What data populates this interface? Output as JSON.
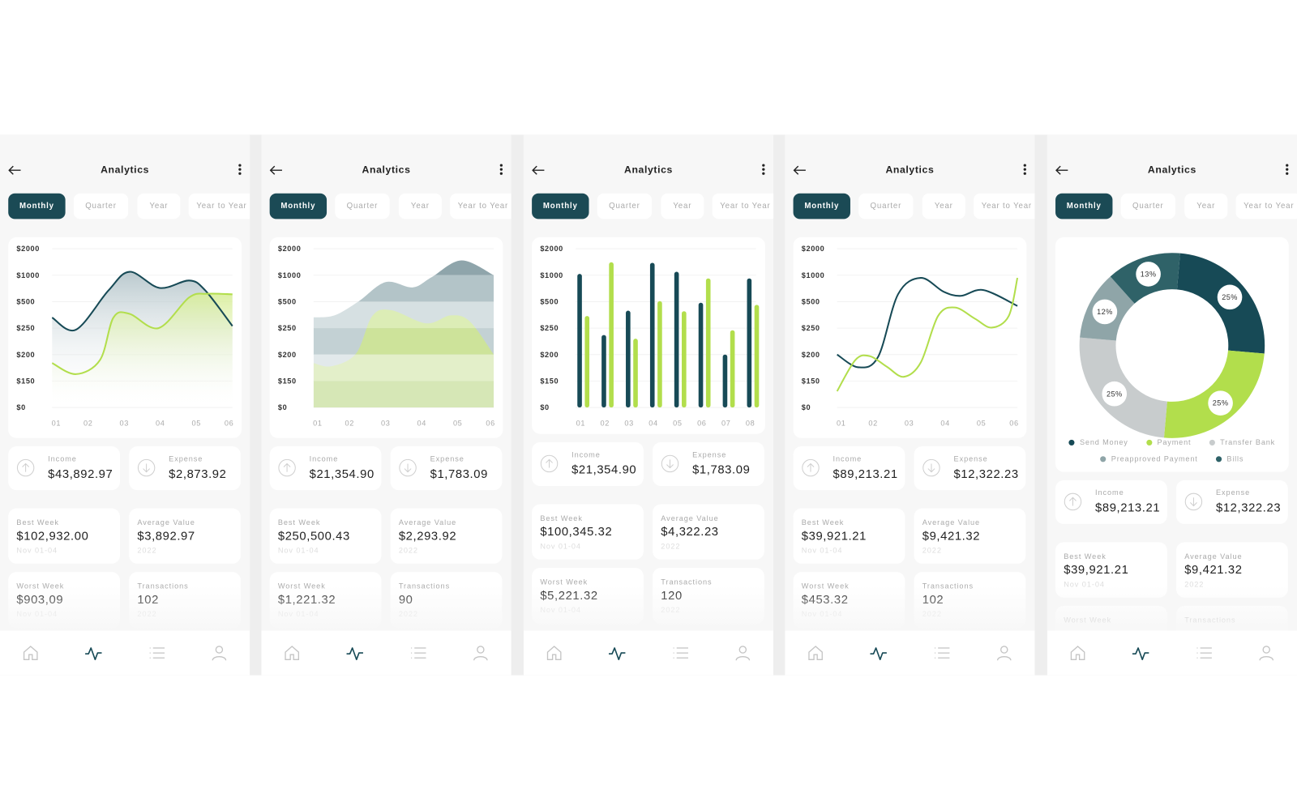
{
  "common": {
    "title": "Analytics",
    "tabs": [
      "Monthly",
      "Quarter",
      "Year",
      "Year to Year"
    ],
    "active_tab": "Monthly",
    "nav": [
      "home-icon",
      "activity-icon",
      "list-icon",
      "user-icon"
    ],
    "active_nav": "activity-icon",
    "income_label": "Income",
    "expense_label": "Expense"
  },
  "colors": {
    "dark": "#174a56",
    "green": "#b2de4c",
    "accent_tab": "#1b4a55"
  },
  "phones": [
    {
      "summary": {
        "income": "$43,892.97",
        "expense": "$2,873.92"
      },
      "stats": [
        {
          "label": "Best Week",
          "value": "$102,932.00",
          "sub": "Nov 01-04"
        },
        {
          "label": "Average Value",
          "value": "$3,892.97",
          "sub": "2022"
        },
        {
          "label": "Worst Week",
          "value": "$903,09",
          "sub": "Nov 01-04"
        },
        {
          "label": "Transactions",
          "value": "102",
          "sub": "2022"
        }
      ]
    },
    {
      "summary": {
        "income": "$21,354.90",
        "expense": "$1,783.09"
      },
      "stats": [
        {
          "label": "Best Week",
          "value": "$250,500.43",
          "sub": "Nov 01-04"
        },
        {
          "label": "Average Value",
          "value": "$2,293.92",
          "sub": "2022"
        },
        {
          "label": "Worst Week",
          "value": "$1,221.32",
          "sub": "Nov 01-04"
        },
        {
          "label": "Transactions",
          "value": "90",
          "sub": "2022"
        }
      ]
    },
    {
      "summary": {
        "income": "$21,354.90",
        "expense": "$1,783.09"
      },
      "stats": [
        {
          "label": "Best Week",
          "value": "$100,345.32",
          "sub": "Nov 01-04"
        },
        {
          "label": "Average Value",
          "value": "$4,322.23",
          "sub": "2022"
        },
        {
          "label": "Worst Week",
          "value": "$5,221.32",
          "sub": "Nov 01-04"
        },
        {
          "label": "Transactions",
          "value": "120",
          "sub": "2022"
        }
      ]
    },
    {
      "summary": {
        "income": "$89,213.21",
        "expense": "$12,322.23"
      },
      "stats": [
        {
          "label": "Best Week",
          "value": "$39,921.21",
          "sub": "Nov 01-04"
        },
        {
          "label": "Average Value",
          "value": "$9,421.32",
          "sub": "2022"
        },
        {
          "label": "Worst Week",
          "value": "$453.32",
          "sub": "Nov 01-04"
        },
        {
          "label": "Transactions",
          "value": "102",
          "sub": "2022"
        }
      ]
    },
    {
      "summary": {
        "income": "$89,213.21",
        "expense": "$12,322.23"
      },
      "stats": [
        {
          "label": "Best Week",
          "value": "$39,921.21",
          "sub": "Nov 01-04"
        },
        {
          "label": "Average Value",
          "value": "$9,421.32",
          "sub": "2022"
        },
        {
          "label": "Worst Week",
          "value": "",
          "sub": ""
        },
        {
          "label": "Transactions",
          "value": "",
          "sub": ""
        }
      ]
    }
  ],
  "chart_data": [
    {
      "type": "area",
      "style": "smooth line with gradient fill",
      "yticks": [
        2000,
        1000,
        500,
        250,
        200,
        150,
        0
      ],
      "ytick_labels": [
        "$2000",
        "$1000",
        "$500",
        "$250",
        "$200",
        "$150",
        "$0"
      ],
      "xtick_labels": [
        "01",
        "02",
        "03",
        "04",
        "05",
        "06"
      ],
      "xlim": [
        1,
        6
      ],
      "grid": true,
      "series": [
        {
          "color": "#174a56",
          "x": [
            1,
            1.66,
            2.56,
            3.15,
            3.98,
            4.8,
            5.25,
            6
          ],
          "y": [
            350,
            247,
            710,
            1130,
            760,
            900,
            710,
            270
          ]
        },
        {
          "color": "#b2de4c",
          "x": [
            1,
            1.66,
            2.33,
            2.7,
            3.15,
            3.95,
            4.8,
            5.3,
            6
          ],
          "y": [
            184,
            163,
            190,
            350,
            385,
            250,
            580,
            650,
            640
          ]
        }
      ]
    },
    {
      "type": "area",
      "style": "stacked banded area",
      "yticks": [
        2000,
        1000,
        500,
        250,
        200,
        150,
        0
      ],
      "ytick_labels": [
        "$2000",
        "$1000",
        "$500",
        "$250",
        "$200",
        "$150",
        "$0"
      ],
      "xtick_labels": [
        "01",
        "02",
        "03",
        "04",
        "05",
        "06"
      ],
      "xlim": [
        1,
        6
      ],
      "grid": true,
      "series": [
        {
          "color": "#8fa5ab",
          "x": [
            1,
            1.58,
            2.25,
            3.0,
            3.75,
            4.27,
            5.1,
            6
          ],
          "y": [
            352,
            370,
            505,
            870,
            770,
            960,
            1560,
            1000
          ]
        },
        {
          "color": "#cde39a",
          "x": [
            1,
            1.5,
            2.18,
            2.63,
            3.15,
            4.13,
            4.8,
            5.33,
            6
          ],
          "y": [
            184,
            178,
            202,
            365,
            420,
            295,
            370,
            315,
            200
          ]
        }
      ]
    },
    {
      "type": "bar",
      "yticks": [
        2000,
        1000,
        500,
        250,
        200,
        150,
        0
      ],
      "ytick_labels": [
        "$2000",
        "$1000",
        "$500",
        "$250",
        "$200",
        "$150",
        "$0"
      ],
      "categories": [
        "01",
        "02",
        "03",
        "04",
        "05",
        "06",
        "07",
        "08"
      ],
      "grid": true,
      "series": [
        {
          "color": "#174a56",
          "values": [
            1050,
            237,
            415,
            1470,
            1130,
            490,
            200,
            940
          ]
        },
        {
          "color": "#b2de4c",
          "values": [
            365,
            1490,
            230,
            510,
            410,
            940,
            246,
            470
          ]
        }
      ]
    },
    {
      "type": "line",
      "yticks": [
        2000,
        1000,
        500,
        250,
        200,
        150,
        0
      ],
      "ytick_labels": [
        "$2000",
        "$1000",
        "$500",
        "$250",
        "$200",
        "$150",
        "$0"
      ],
      "xtick_labels": [
        "01",
        "02",
        "03",
        "04",
        "05",
        "06"
      ],
      "xlim": [
        1,
        6
      ],
      "grid": true,
      "series": [
        {
          "color": "#174a56",
          "x": [
            1,
            1.59,
            2.14,
            2.69,
            3.32,
            3.95,
            4.43,
            5.06,
            6
          ],
          "y": [
            200,
            176,
            196,
            640,
            950,
            690,
            610,
            720,
            460
          ]
        },
        {
          "color": "#b2de4c",
          "x": [
            1,
            1.51,
            1.91,
            2.38,
            2.85,
            3.32,
            3.8,
            4.27,
            4.82,
            5.29,
            5.76,
            6
          ],
          "y": [
            92,
            190,
            197,
            177,
            158,
            185,
            365,
            445,
            340,
            255,
            365,
            950
          ]
        }
      ]
    },
    {
      "type": "pie",
      "style": "donut",
      "legend": "bottom",
      "slices": [
        {
          "name": "Send Money",
          "value": 25,
          "label": "25%",
          "color": "#174a56"
        },
        {
          "name": "Payment",
          "value": 25,
          "label": "25%",
          "color": "#b2de4c"
        },
        {
          "name": "Transfer Bank",
          "value": 25,
          "label": "25%",
          "color": "#c8cccd"
        },
        {
          "name": "Preapproved Payment",
          "value": 12,
          "label": "12%",
          "color": "#8fa5a8"
        },
        {
          "name": "Bills",
          "value": 13,
          "label": "13%",
          "color": "#2f6268"
        }
      ]
    }
  ]
}
